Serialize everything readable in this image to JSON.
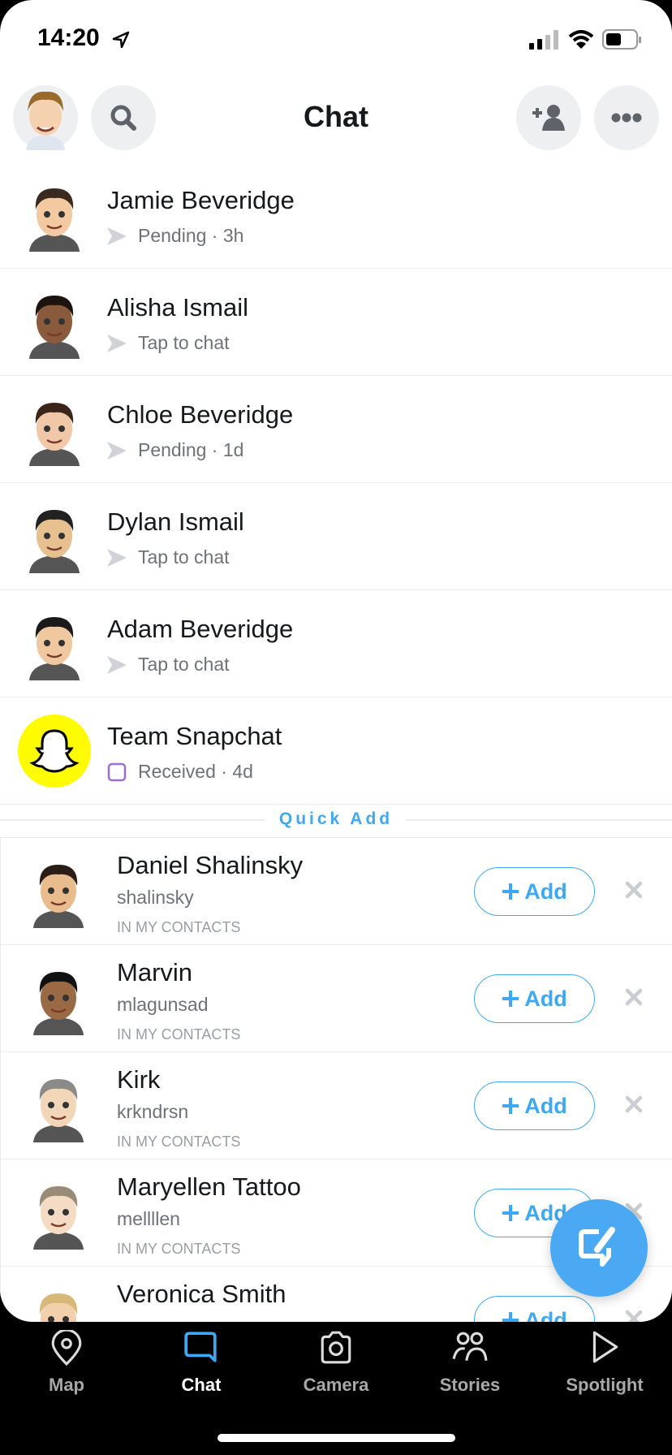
{
  "status_bar": {
    "time": "14:20"
  },
  "header": {
    "title": "Chat"
  },
  "chats": [
    {
      "name": "Jamie Beveridge",
      "status": "Pending",
      "time": "3h",
      "icon": "sent-arrow-icon",
      "skin": "#f2c9a0",
      "hair": "#3a2a20"
    },
    {
      "name": "Alisha Ismail",
      "status": "Tap to chat",
      "icon": "sent-arrow-icon",
      "skin": "#8a5a3c",
      "hair": "#1d1410"
    },
    {
      "name": "Chloe Beveridge",
      "status": "Pending",
      "time": "1d",
      "icon": "sent-arrow-icon",
      "skin": "#f0c8a8",
      "hair": "#3b2418"
    },
    {
      "name": "Dylan Ismail",
      "status": "Tap to chat",
      "icon": "sent-arrow-icon",
      "skin": "#e6c08f",
      "hair": "#222"
    },
    {
      "name": "Adam Beveridge",
      "status": "Tap to chat",
      "icon": "sent-arrow-icon",
      "skin": "#f0c8a0",
      "hair": "#1a1a1a"
    },
    {
      "name": "Team Snapchat",
      "status": "Received",
      "time": "4d",
      "icon": "received-square-icon"
    }
  ],
  "quick_add": {
    "title": "Quick Add",
    "add_label": "Add",
    "items": [
      {
        "name": "Daniel Shalinsky",
        "username": "shalinsky",
        "tag": "IN MY CONTACTS",
        "skin": "#e8bc8c",
        "hair": "#2a1d16"
      },
      {
        "name": "Marvin",
        "username": "mlagunsad",
        "tag": "IN MY CONTACTS",
        "skin": "#9a6a44",
        "hair": "#111"
      },
      {
        "name": "Kirk",
        "username": "krkndrsn",
        "tag": "IN MY CONTACTS",
        "skin": "#f2d6b8",
        "hair": "#8a8a86"
      },
      {
        "name": "Maryellen Tattoo",
        "username": "mellllen",
        "tag": "IN MY CONTACTS",
        "skin": "#f4dcc4",
        "hair": "#9a8a78"
      },
      {
        "name": "Veronica Smith",
        "username": "",
        "tag": "",
        "skin": "#f2d0ac",
        "hair": "#d8b878"
      }
    ]
  },
  "nav": [
    {
      "label": "Map",
      "icon": "map-pin-icon"
    },
    {
      "label": "Chat",
      "icon": "chat-bubble-icon",
      "active": true
    },
    {
      "label": "Camera",
      "icon": "camera-icon"
    },
    {
      "label": "Stories",
      "icon": "stories-icon"
    },
    {
      "label": "Spotlight",
      "icon": "spotlight-play-icon"
    }
  ],
  "colors": {
    "accent": "#3fa8f4",
    "snap_yellow": "#fffc00",
    "fab": "#4aa9f2",
    "received": "#9b6fd0"
  }
}
